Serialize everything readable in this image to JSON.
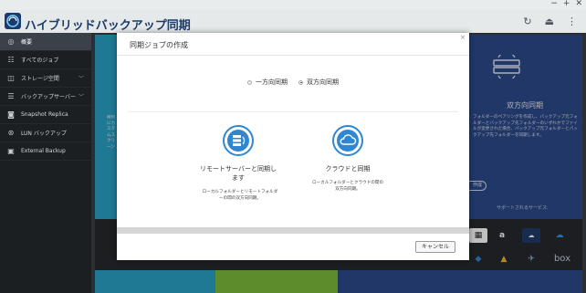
{
  "window": {
    "title": "ハイブリッドバックアップ同期",
    "controls": [
      "−",
      "+",
      "✕"
    ],
    "toolbar_icons": [
      "refresh-icon",
      "upload-icon",
      "more-icon"
    ]
  },
  "sidebar": {
    "items": [
      {
        "label": "概要",
        "icon": "overview-icon",
        "active": true
      },
      {
        "label": "すべてのジョブ",
        "icon": "jobs-icon"
      },
      {
        "label": "ストレージ空間",
        "icon": "storage-icon",
        "has_children": true
      },
      {
        "label": "バックアップサーバー",
        "icon": "server-icon",
        "has_children": true
      },
      {
        "label": "Snapshot Replica",
        "icon": "snapshot-icon"
      },
      {
        "label": "LUN バックアップ",
        "icon": "lun-icon"
      },
      {
        "label": "External Backup",
        "icon": "external-icon"
      }
    ]
  },
  "background": {
    "right_panel_title": "双方向同期",
    "right_panel_desc": "フォルダーのペアリングを作成し、バックアップ元フォルダーとバックアップ先フォルダーのいずれかでファイルが変更された場合、バックアップ元フォルダーとバックアップ先フォルダーを同期します。",
    "left_panel_desc": "最初にカスタムスクリーン",
    "create_button": "作成",
    "supported_services": "サポートされるサービス:",
    "services": [
      "amazon-icon",
      "azure-icon",
      "onedrive-icon",
      "dropbox-icon",
      "drive-icon",
      "hicloud-icon",
      "box-icon"
    ]
  },
  "modal": {
    "title": "同期ジョブの作成",
    "close": "×",
    "mode_options": [
      {
        "label": "一方向同期",
        "selected": false
      },
      {
        "label": "双方向同期",
        "selected": true
      }
    ],
    "option_remote": {
      "title_line1": "リモートサーバーと同期し",
      "title_line2": "ます",
      "desc_line1": "ローカルフォルダーとリモートフォルダ",
      "desc_line2": "ーの間の双方向同期。"
    },
    "option_cloud": {
      "title": "クラウドと同期",
      "desc_line1": "ローカルフォルダーとクラウドの間の",
      "desc_line2": "双方向同期。"
    },
    "cancel_label": "キャンセル"
  }
}
